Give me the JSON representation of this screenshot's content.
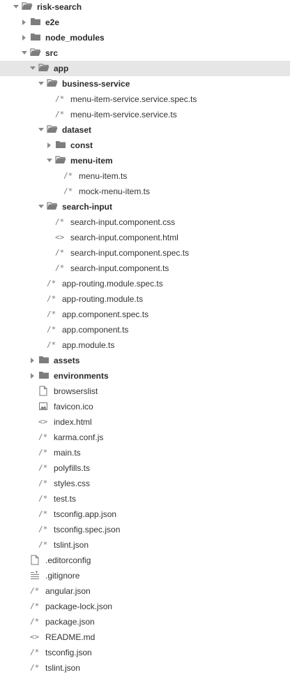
{
  "tree": [
    {
      "label": "risk-search",
      "type": "folder",
      "depth": 0,
      "expanded": true,
      "icon": "folder-open-icon"
    },
    {
      "label": "e2e",
      "type": "folder",
      "depth": 1,
      "expanded": false,
      "icon": "folder-icon"
    },
    {
      "label": "node_modules",
      "type": "folder",
      "depth": 1,
      "expanded": false,
      "icon": "folder-icon"
    },
    {
      "label": "src",
      "type": "folder",
      "depth": 1,
      "expanded": true,
      "icon": "folder-open-icon"
    },
    {
      "label": "app",
      "type": "folder",
      "depth": 2,
      "expanded": true,
      "icon": "folder-open-icon",
      "selected": true
    },
    {
      "label": "business-service",
      "type": "folder",
      "depth": 3,
      "expanded": true,
      "icon": "folder-open-icon"
    },
    {
      "label": "menu-item-service.service.spec.ts",
      "type": "file",
      "depth": 4,
      "icon": "comment-icon",
      "glyph": "/*"
    },
    {
      "label": "menu-item-service.service.ts",
      "type": "file",
      "depth": 4,
      "icon": "comment-icon",
      "glyph": "/*"
    },
    {
      "label": "dataset",
      "type": "folder",
      "depth": 3,
      "expanded": true,
      "icon": "folder-open-icon"
    },
    {
      "label": "const",
      "type": "folder",
      "depth": 4,
      "expanded": false,
      "icon": "folder-icon"
    },
    {
      "label": "menu-item",
      "type": "folder",
      "depth": 4,
      "expanded": true,
      "icon": "folder-open-icon"
    },
    {
      "label": "menu-item.ts",
      "type": "file",
      "depth": 5,
      "icon": "comment-icon",
      "glyph": "/*"
    },
    {
      "label": "mock-menu-item.ts",
      "type": "file",
      "depth": 5,
      "icon": "comment-icon",
      "glyph": "/*"
    },
    {
      "label": "search-input",
      "type": "folder",
      "depth": 3,
      "expanded": true,
      "icon": "folder-open-icon"
    },
    {
      "label": "search-input.component.css",
      "type": "file",
      "depth": 4,
      "icon": "comment-icon",
      "glyph": "/*"
    },
    {
      "label": "search-input.component.html",
      "type": "file",
      "depth": 4,
      "icon": "code-icon",
      "glyph": "<>"
    },
    {
      "label": "search-input.component.spec.ts",
      "type": "file",
      "depth": 4,
      "icon": "comment-icon",
      "glyph": "/*"
    },
    {
      "label": "search-input.component.ts",
      "type": "file",
      "depth": 4,
      "icon": "comment-icon",
      "glyph": "/*"
    },
    {
      "label": "app-routing.module.spec.ts",
      "type": "file",
      "depth": 3,
      "icon": "comment-icon",
      "glyph": "/*"
    },
    {
      "label": "app-routing.module.ts",
      "type": "file",
      "depth": 3,
      "icon": "comment-icon",
      "glyph": "/*"
    },
    {
      "label": "app.component.spec.ts",
      "type": "file",
      "depth": 3,
      "icon": "comment-icon",
      "glyph": "/*"
    },
    {
      "label": "app.component.ts",
      "type": "file",
      "depth": 3,
      "icon": "comment-icon",
      "glyph": "/*"
    },
    {
      "label": "app.module.ts",
      "type": "file",
      "depth": 3,
      "icon": "comment-icon",
      "glyph": "/*"
    },
    {
      "label": "assets",
      "type": "folder",
      "depth": 2,
      "expanded": false,
      "icon": "folder-icon"
    },
    {
      "label": "environments",
      "type": "folder",
      "depth": 2,
      "expanded": false,
      "icon": "folder-icon"
    },
    {
      "label": "browserslist",
      "type": "file",
      "depth": 2,
      "icon": "document-icon"
    },
    {
      "label": "favicon.ico",
      "type": "file",
      "depth": 2,
      "icon": "image-icon"
    },
    {
      "label": "index.html",
      "type": "file",
      "depth": 2,
      "icon": "code-icon",
      "glyph": "<>"
    },
    {
      "label": "karma.conf.js",
      "type": "file",
      "depth": 2,
      "icon": "comment-icon",
      "glyph": "/*"
    },
    {
      "label": "main.ts",
      "type": "file",
      "depth": 2,
      "icon": "comment-icon",
      "glyph": "/*"
    },
    {
      "label": "polyfills.ts",
      "type": "file",
      "depth": 2,
      "icon": "comment-icon",
      "glyph": "/*"
    },
    {
      "label": "styles.css",
      "type": "file",
      "depth": 2,
      "icon": "comment-icon",
      "glyph": "/*"
    },
    {
      "label": "test.ts",
      "type": "file",
      "depth": 2,
      "icon": "comment-icon",
      "glyph": "/*"
    },
    {
      "label": "tsconfig.app.json",
      "type": "file",
      "depth": 2,
      "icon": "comment-icon",
      "glyph": "/*"
    },
    {
      "label": "tsconfig.spec.json",
      "type": "file",
      "depth": 2,
      "icon": "comment-icon",
      "glyph": "/*"
    },
    {
      "label": "tslint.json",
      "type": "file",
      "depth": 2,
      "icon": "comment-icon",
      "glyph": "/*"
    },
    {
      "label": ".editorconfig",
      "type": "file",
      "depth": 1,
      "icon": "document-icon"
    },
    {
      "label": ".gitignore",
      "type": "file",
      "depth": 1,
      "icon": "list-icon"
    },
    {
      "label": "angular.json",
      "type": "file",
      "depth": 1,
      "icon": "comment-icon",
      "glyph": "/*"
    },
    {
      "label": "package-lock.json",
      "type": "file",
      "depth": 1,
      "icon": "comment-icon",
      "glyph": "/*"
    },
    {
      "label": "package.json",
      "type": "file",
      "depth": 1,
      "icon": "comment-icon",
      "glyph": "/*"
    },
    {
      "label": "README.md",
      "type": "file",
      "depth": 1,
      "icon": "code-icon",
      "glyph": "<>"
    },
    {
      "label": "tsconfig.json",
      "type": "file",
      "depth": 1,
      "icon": "comment-icon",
      "glyph": "/*"
    },
    {
      "label": "tslint.json",
      "type": "file",
      "depth": 1,
      "icon": "comment-icon",
      "glyph": "/*"
    }
  ],
  "colors": {
    "folder": "#7d7d7d",
    "icon": "#777777",
    "selected_bg": "#e6e6e6",
    "text": "#333333"
  }
}
